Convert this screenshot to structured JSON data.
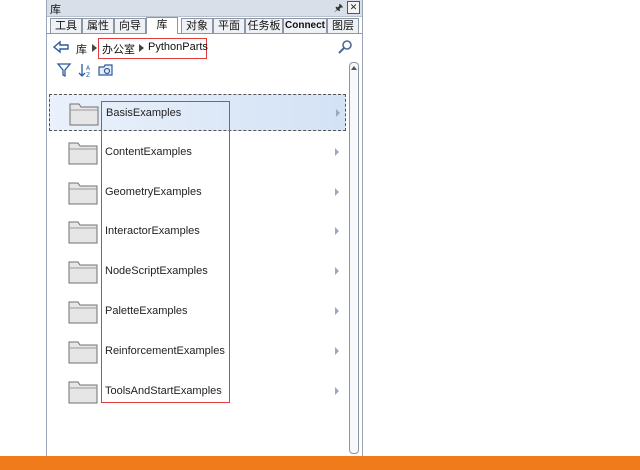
{
  "window": {
    "title": "库",
    "pin_icon": "pin-icon",
    "close_icon": "close-icon"
  },
  "tabs": [
    {
      "label": "工具"
    },
    {
      "label": "属性"
    },
    {
      "label": "向导"
    },
    {
      "label": "库",
      "active": true
    },
    {
      "label": "对象"
    },
    {
      "label": "平面"
    },
    {
      "label": "任务板"
    },
    {
      "label": "Connect"
    },
    {
      "label": "图层"
    }
  ],
  "breadcrumb": {
    "back_icon": "back-arrow-icon",
    "items": [
      "库",
      "办公室",
      "PythonParts"
    ],
    "search_icon": "search-icon"
  },
  "toolbar": {
    "icons": [
      "filter-icon",
      "sort-icon",
      "folder-settings-icon"
    ]
  },
  "list": {
    "items": [
      {
        "label": "BasisExamples",
        "selected": true
      },
      {
        "label": "ContentExamples"
      },
      {
        "label": "GeometryExamples"
      },
      {
        "label": "InteractorExamples"
      },
      {
        "label": "NodeScriptExamples"
      },
      {
        "label": "PaletteExamples"
      },
      {
        "label": "ReinforcementExamples"
      },
      {
        "label": "ToolsAndStartExamples"
      }
    ]
  },
  "colors": {
    "highlight_box": "#e23b3b",
    "bottom_bar": "#f07b1b",
    "selection": "#d3e2f5"
  }
}
